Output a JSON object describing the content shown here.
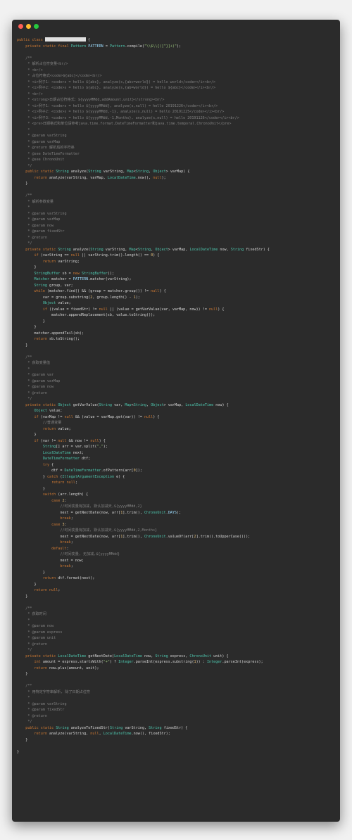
{
  "window": {
    "controls": [
      "close",
      "minimize",
      "maximize"
    ],
    "colors": {
      "background": "#2b2b2b",
      "close": "#ff5f56",
      "minimize": "#ffbd2e",
      "maximize": "#27c93f"
    }
  },
  "code_lines": [
    "public class ▮ {",
    "    private static final Pattern PATTERN = Pattern.compile(\"\\\\$\\\\{([^}]+)\");",
    "",
    "    /**",
    "     * 解析占位符变量<br/>",
    "     * <br/>",
    "     * 占位符格式<code>${abc}</code><br/>",
    "     * <i>例子1：<code>s = hello ${abc}, analyze(s,{abc=world}) = hello world</code></i><br/>",
    "     * <i>例子2：<code>s = hello ${abc}, analyze(s,{ab=world}) = hello ${abc}</code></i><br/>",
    "     * <br/>",
    "     * <strong>日期占位符格式：${yyyyMMdd,addAmount,unit}</strong><br/>",
    "     * <i>例子1：<code>s = hello ${yyyyMMdd}, analyze(s,null) = hello 20191226</code></i><br/>",
    "     * <i>例子2：<code>s = hello ${yyyyMMdd,-1}, analyze(s,null) = hello 20191225</code></i><br/>",
    "     * <i>例子3：<code>s = hello ${yyyyMMdd,-1,Months}, analyze(s,null) = hello 20191126</code></i><br/>",
    "     * <pre>日期格式和单位请参考java.time.format.DateTimeFormatter和java.time.temporal.ChronoUnit</pre>",
    "     *",
    "     * @param varString",
    "     * @param varMap",
    "     * @return 解析后的字符串",
    "     * @see DateTimeFormatter",
    "     * @see ChronoUnit",
    "     */",
    "    public static String analyze(String varString, Map<String, Object> varMap) {",
    "        return analyze(varString, varMap, LocalDateTime.now(), null);",
    "    }",
    "",
    "    /**",
    "     * 解析参数变量",
    "     *",
    "     * @param varString",
    "     * @param varMap",
    "     * @param now",
    "     * @param fixedStr",
    "     * @return",
    "     */",
    "    private static String analyze(String varString, Map<String, Object> varMap, LocalDateTime now, String fixedStr) {",
    "        if (varString == null || varString.trim().length() == 0) {",
    "            return varString;",
    "        }",
    "        StringBuffer sb = new StringBuffer();",
    "        Matcher matcher = PATTERN.matcher(varString);",
    "        String group, var;",
    "        while (matcher.find() && (group = matcher.group()) != null) {",
    "            var = group.substring(2, group.length() - 1);",
    "            Object value;",
    "            if ((value = fixedStr) != null || (value = getVarValue(var, varMap, now)) != null) {",
    "                matcher.appendReplacement(sb, value.toString());",
    "            }",
    "        }",
    "        matcher.appendTail(sb);",
    "        return sb.toString();",
    "    }",
    "",
    "    /**",
    "     * 获取变量值",
    "     *",
    "     * @param var",
    "     * @param varMap",
    "     * @param now",
    "     * @return",
    "     */",
    "    private static Object getVarValue(String var, Map<String, Object> varMap, LocalDateTime now) {",
    "        Object value;",
    "        if (varMap != null && (value = varMap.get(var)) != null) {",
    "            //普通变量",
    "            return value;",
    "        }",
    "        if (var != null && now != null) {",
    "            String[] arr = var.split(\",\");",
    "            LocalDateTime next;",
    "            DateTimeFormatter dtf;",
    "            try {",
    "                dtf = DateTimeFormatter.ofPattern(arr[0]);",
    "            } catch (IllegalArgumentException e) {",
    "                return null;",
    "            }",
    "            switch (arr.length) {",
    "                case 2:",
    "                    //时间变量有加减, 默认加减天,${yyyyMMdd,2}",
    "                    next = getNextDate(now, arr[1].trim(), ChronoUnit.DAYS);",
    "                    break;",
    "                case 3:",
    "                    //时间变量有加减, 默认加减天,${yyyyMMdd,2,Months}",
    "                    next = getNextDate(now, arr[1].trim(), ChronoUnit.valueOf(arr[2].trim().toUpperCase()));",
    "                    break;",
    "                default:",
    "                    //时间变量, 无加减,${yyyyMMdd}",
    "                    next = now;",
    "                    break;",
    "            }",
    "            return dtf.format(next);",
    "        }",
    "        return null;",
    "    }",
    "",
    "    /**",
    "     * 获取时间",
    "     *",
    "     * @param now",
    "     * @param express",
    "     * @param unit",
    "     * @return",
    "     */",
    "    private static LocalDateTime getNextDate(LocalDateTime now, String express, ChronoUnit unit) {",
    "        int amount = express.startsWith(\"+\") ? Integer.parseInt(express.substring(1)) : Integer.parseInt(express);",
    "        return now.plus(amount, unit);",
    "    }",
    "",
    "    /**",
    "     * 用特定字符串解析, 除了日期占位符",
    "     *",
    "     * @param varString",
    "     * @param fixedStr",
    "     * @return",
    "     */",
    "    public static String analyzeToFixedStr(String varString, String fixedStr) {",
    "        return analyze(varString, null, LocalDateTime.now(), fixedStr);",
    "    }",
    "",
    "}"
  ]
}
